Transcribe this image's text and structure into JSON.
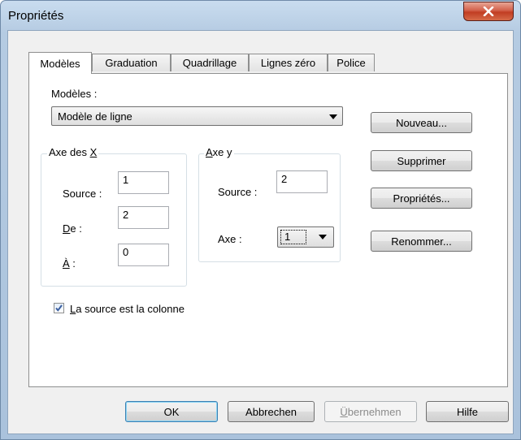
{
  "window": {
    "title": "Propriétés"
  },
  "tabs": [
    {
      "label": "Modèles"
    },
    {
      "label": "Graduation"
    },
    {
      "label": "Quadrillage"
    },
    {
      "label": "Lignes zéro"
    },
    {
      "label": "Police"
    }
  ],
  "models": {
    "label": "Modèles :",
    "selected": "Modèle de ligne"
  },
  "side_buttons": {
    "new": "Nouveau...",
    "delete": "Supprimer",
    "properties": "Propriétés...",
    "rename": "Renommer..."
  },
  "x_axis": {
    "legend_prefix": "Axe des ",
    "legend_key": "X",
    "source_label": "Source :",
    "source_value": "1",
    "from_label_key": "D",
    "from_label_rest": "e :",
    "from_value": "2",
    "to_label_key": "À",
    "to_label_rest": " :",
    "to_value": "0"
  },
  "y_axis": {
    "legend_key": "A",
    "legend_rest": "xe y",
    "source_label": "Source :",
    "source_value": "2",
    "axis_label": "Axe :",
    "axis_value": "1"
  },
  "checkbox": {
    "label_key": "L",
    "label_rest": "a source est la colonne",
    "checked": true
  },
  "footer": {
    "ok": "OK",
    "cancel": "Abbrechen",
    "apply_key": "Ü",
    "apply_rest": "bernehmen",
    "help": "Hilfe"
  },
  "colors": {
    "check": "#3a5fa0",
    "close_button": "#c7432a"
  }
}
